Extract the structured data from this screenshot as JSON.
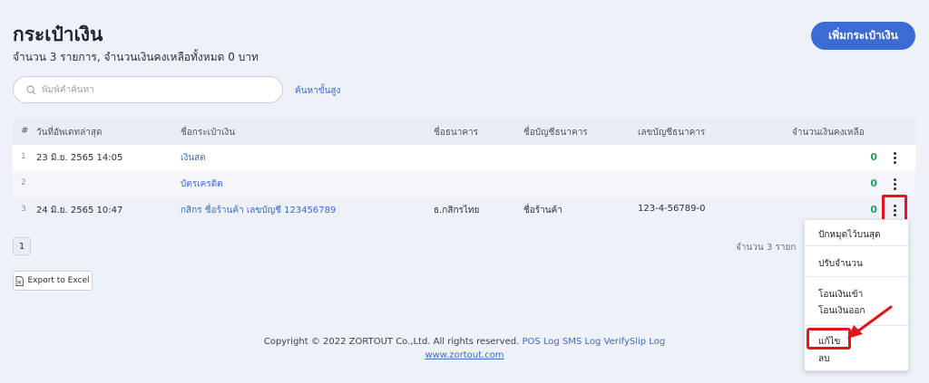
{
  "header": {
    "title": "กระเป๋าเงิน",
    "subtitle": "จำนวน 3 รายการ, จำนวนเงินคงเหลือทั้งหมด 0 บาท",
    "add_button": "เพิ่มกระเป๋าเงิน"
  },
  "search": {
    "placeholder": "พิมพ์คำค้นหา",
    "advanced_label": "ค้นหาขั้นสูง"
  },
  "table": {
    "headers": {
      "index": "#",
      "updated": "วันที่อัพเดทล่าสุด",
      "name": "ชื่อกระเป๋าเงิน",
      "bank": "ชื่อธนาคาร",
      "account_name": "ชื่อบัญชีธนาคาร",
      "account_no": "เลขบัญชีธนาคาร",
      "balance": "จำนวนเงินคงเหลือ"
    },
    "rows": [
      {
        "index": "1",
        "updated": "23 มิ.ย. 2565 14:05",
        "name": "เงินสด",
        "bank": "",
        "account_name": "",
        "account_no": "",
        "balance": "0"
      },
      {
        "index": "2",
        "updated": "",
        "name": "บัตรเครดิต",
        "bank": "",
        "account_name": "",
        "account_no": "",
        "balance": "0"
      },
      {
        "index": "3",
        "updated": "24 มิ.ย. 2565 10:47",
        "name": "กสิกร ชื่อร้านค้า เลขบัญชี 123456789",
        "bank": "ธ.กสิกรไทย",
        "account_name": "ชื่อร้านค้า",
        "account_no": "123-4-56789-0",
        "balance": "0"
      }
    ]
  },
  "pagination": {
    "page": "1",
    "count_text": "จำนวน 3 รายก"
  },
  "export_label": "Export to Excel",
  "footer": {
    "copyright": "Copyright © 2022 ZORTOUT Co.,Ltd. All rights reserved.",
    "links": [
      "POS",
      "Log",
      "SMS Log",
      "VerifySlip Log"
    ],
    "site": "www.zortout.com"
  },
  "dropdown": {
    "items": [
      "ปักหมุดไว้บนสุด",
      "ปรับจำนวน",
      "โอนเงินเข้า",
      "โอนเงินออก",
      "แก้ไข",
      "ลบ"
    ]
  },
  "colors": {
    "accent": "#3d6bd6",
    "link": "#3a6ad0",
    "positive": "#1fa35a",
    "annotation": "#e3141c"
  }
}
